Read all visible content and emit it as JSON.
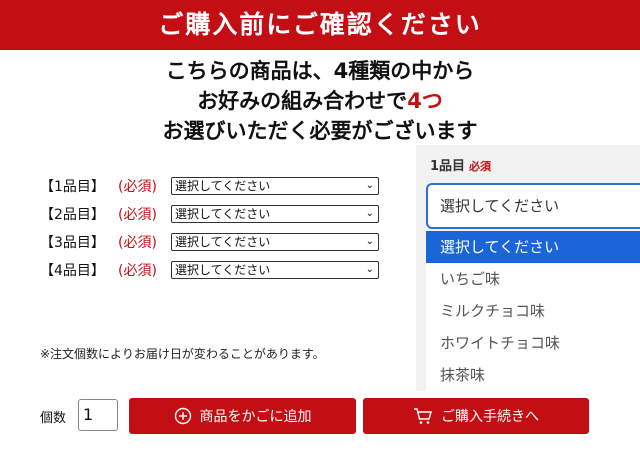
{
  "banner": {
    "title": "ご購入前にご確認ください"
  },
  "headline": {
    "line1": "こちらの商品は、4種類の中から",
    "line2_pre": "お好みの組み合わせで",
    "line2_red": "4つ",
    "line3": "お選びいただく必要がございます"
  },
  "rows": [
    {
      "label": "【1品目】",
      "required": "(必須)",
      "value": "選択してください"
    },
    {
      "label": "【2品目】",
      "required": "(必須)",
      "value": "選択してください"
    },
    {
      "label": "【3品目】",
      "required": "(必須)",
      "value": "選択してください"
    },
    {
      "label": "【4品目】",
      "required": "(必須)",
      "value": "選択してください"
    }
  ],
  "panel": {
    "title": "1品目",
    "required": "必須",
    "selected": "選択してください",
    "options": [
      "選択してください",
      "いちご味",
      "ミルクチョコ味",
      "ホワイトチョコ味",
      "抹茶味"
    ]
  },
  "note": "※注文個数によりお届け日が変わることがあります。",
  "quantity": {
    "label": "個数",
    "value": "1"
  },
  "buttons": {
    "add_to_cart": "商品をかごに追加",
    "checkout": "ご購入手続きへ"
  },
  "colors": {
    "brand_red": "#c30f14",
    "selection_blue": "#1a66d8"
  }
}
